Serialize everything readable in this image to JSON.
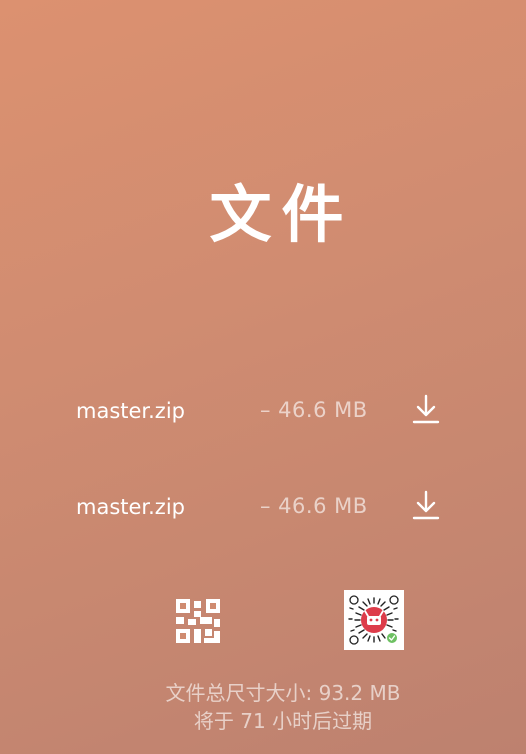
{
  "page": {
    "title": "文件"
  },
  "files": [
    {
      "name": "master.zip",
      "size": "– 46.6 MB",
      "action_icon": "download-icon"
    },
    {
      "name": "master.zip",
      "size": "– 46.6 MB",
      "action_icon": "download-icon"
    }
  ],
  "actions": {
    "qr_icon": "qr-code-icon",
    "mini_program_icon": "mini-program-code-icon"
  },
  "footer": {
    "total_size": "文件总尺寸大小: 93.2 MB",
    "expiry": "将于 71 小时后过期"
  },
  "colors": {
    "background_start": "#dc9170",
    "background_end": "#bd816f",
    "text": "#ffffff",
    "muted_text": "rgba(255,255,255,0.62)",
    "mini_code_center": "#dd3c4a",
    "mini_code_badge": "#6dc062"
  }
}
